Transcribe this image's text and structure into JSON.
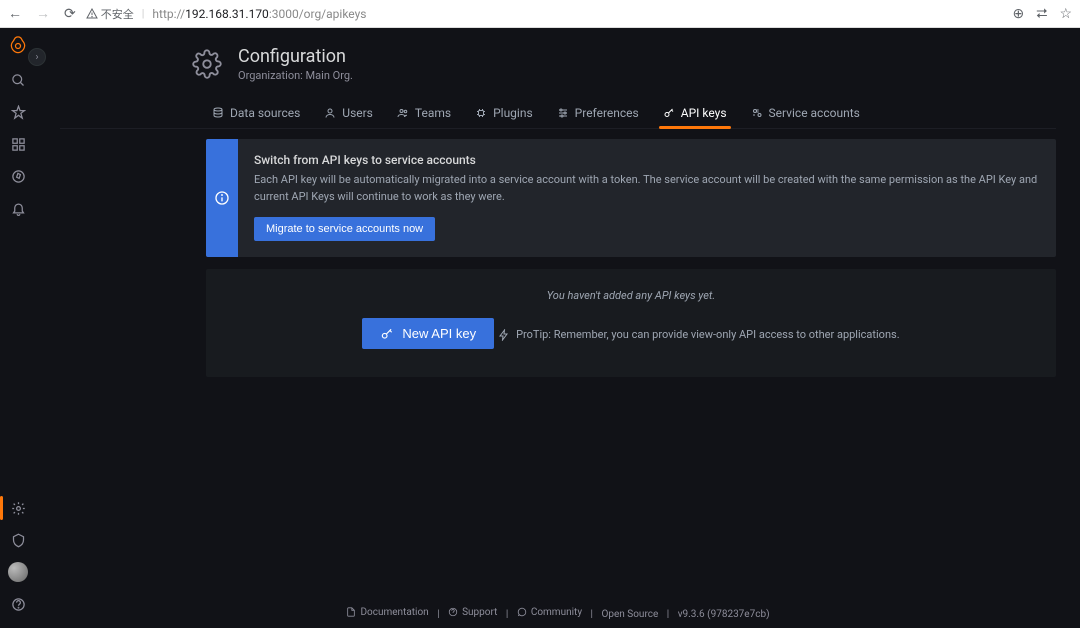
{
  "browser": {
    "insecure_label": "不安全",
    "url_prefix": "http://",
    "url_host": "192.168.31.170",
    "url_port_path": ":3000/org/apikeys"
  },
  "sidebar": {
    "items": [
      "search",
      "star",
      "dashboard",
      "compass",
      "bell"
    ],
    "bottom": [
      "config",
      "shield",
      "avatar",
      "help"
    ]
  },
  "header": {
    "title": "Configuration",
    "subtitle": "Organization: Main Org."
  },
  "tabs": [
    {
      "label": "Data sources",
      "icon": "database"
    },
    {
      "label": "Users",
      "icon": "user"
    },
    {
      "label": "Teams",
      "icon": "users"
    },
    {
      "label": "Plugins",
      "icon": "plug"
    },
    {
      "label": "Preferences",
      "icon": "sliders"
    },
    {
      "label": "API keys",
      "icon": "key",
      "active": true
    },
    {
      "label": "Service accounts",
      "icon": "gears"
    }
  ],
  "banner": {
    "title": "Switch from API keys to service accounts",
    "desc": "Each API key will be automatically migrated into a service account with a token. The service account will be created with the same permission as the API Key and current API Keys will continue to work as they were.",
    "button": "Migrate to service accounts now"
  },
  "panel": {
    "empty": "You haven't added any API keys yet.",
    "new_button": "New API key",
    "protip": "ProTip: Remember, you can provide view-only API access to other applications."
  },
  "footer": {
    "documentation": "Documentation",
    "support": "Support",
    "community": "Community",
    "opensource": "Open Source",
    "version": "v9.3.6 (978237e7cb)"
  }
}
